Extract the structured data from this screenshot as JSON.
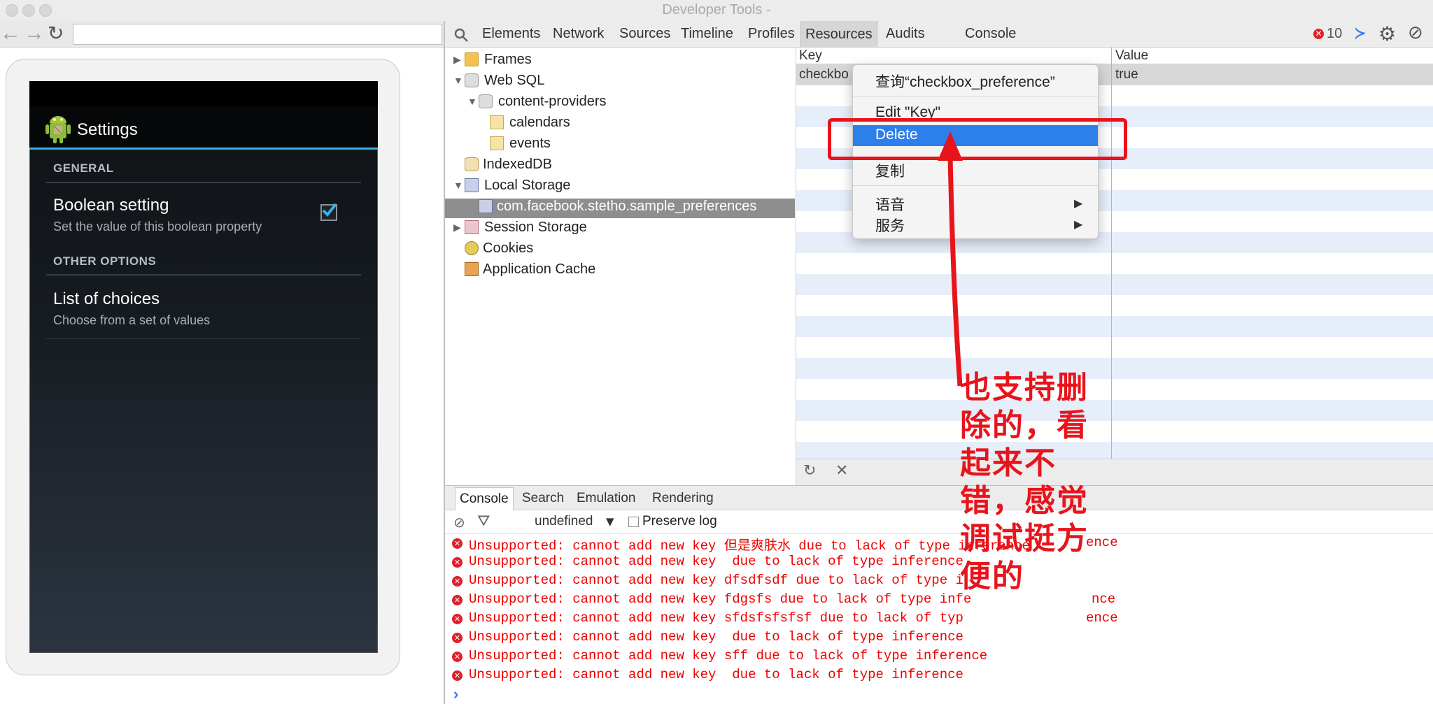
{
  "window": {
    "title": "Developer Tools -"
  },
  "browser": {
    "back_icon": "back-arrow-icon",
    "forward_icon": "forward-arrow-icon",
    "reload_icon": "reload-icon",
    "url": ""
  },
  "android": {
    "app_title": "Settings",
    "sections": [
      {
        "header": "GENERAL"
      },
      {
        "header": "OTHER OPTIONS"
      }
    ],
    "prefs": [
      {
        "title": "Boolean setting",
        "summary": "Set the value of this boolean property",
        "checked": true
      },
      {
        "title": "List of choices",
        "summary": "Choose from a set of values"
      }
    ]
  },
  "devtools": {
    "tabs": [
      "Elements",
      "Network",
      "Sources",
      "Timeline",
      "Profiles",
      "Resources",
      "Audits",
      "Console"
    ],
    "selected_tab": "Resources",
    "error_count": "10"
  },
  "resources_tree": [
    {
      "label": "Frames"
    },
    {
      "label": "Web SQL"
    },
    {
      "label": "content-providers"
    },
    {
      "label": "calendars"
    },
    {
      "label": "events"
    },
    {
      "label": "IndexedDB"
    },
    {
      "label": "Local Storage"
    },
    {
      "label": "com.facebook.stetho.sample_preferences"
    },
    {
      "label": "Session Storage"
    },
    {
      "label": "Cookies"
    },
    {
      "label": "Application Cache"
    }
  ],
  "storage_grid": {
    "headers": {
      "key": "Key",
      "value": "Value"
    },
    "rows": [
      {
        "key": "checkbo",
        "value": "true"
      }
    ]
  },
  "context_menu": {
    "items": [
      {
        "label": "查询“checkbox_preference”"
      },
      {
        "label": "Edit \"Key\""
      },
      {
        "label": "Delete"
      },
      {
        "label": "复制"
      },
      {
        "label": "语音"
      },
      {
        "label": "服务"
      }
    ],
    "submenu_arrow": "▶"
  },
  "console_drawer": {
    "tabs": [
      "Console",
      "Search",
      "Emulation",
      "Rendering"
    ],
    "context": "undefined",
    "preserve_log": "Preserve log",
    "messages": [
      "Unsupported: cannot add new key 但是爽肤水 due to lack of type inference",
      "Unsupported: cannot add new key  due to lack of type inference",
      "Unsupported: cannot add new key dfsdfsdf due to lack of type i",
      "Unsupported: cannot add new key fdgsfs due to lack of type infe",
      "Unsupported: cannot add new key sfdsfsfsfsf due to lack of typ",
      "Unsupported: cannot add new key  due to lack of type inference",
      "Unsupported: cannot add new key sff due to lack of type inference",
      "Unsupported: cannot add new key  due to lack of type inference"
    ],
    "message_tails": [
      "ence",
      "",
      "",
      "nce",
      "ence"
    ],
    "prompt": "›"
  },
  "annotation": {
    "lines": [
      "也支持删",
      "除的，看",
      "起来不",
      "错，感觉",
      "调试挺方",
      "便的"
    ],
    "color": "#e8141c"
  }
}
